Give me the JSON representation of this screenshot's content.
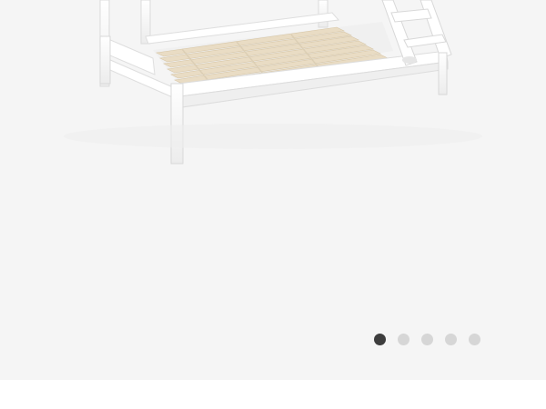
{
  "gallery": {
    "image": {
      "subject": "bunk-bed-icon"
    },
    "pagination": {
      "total": 5,
      "active_index": 0
    },
    "colors": {
      "background": "#f5f5f5",
      "frame": "#ffffff",
      "slats": "#e9dcc4",
      "dot_active": "#3d3d3d",
      "dot_inactive": "#d6d6d6"
    }
  }
}
